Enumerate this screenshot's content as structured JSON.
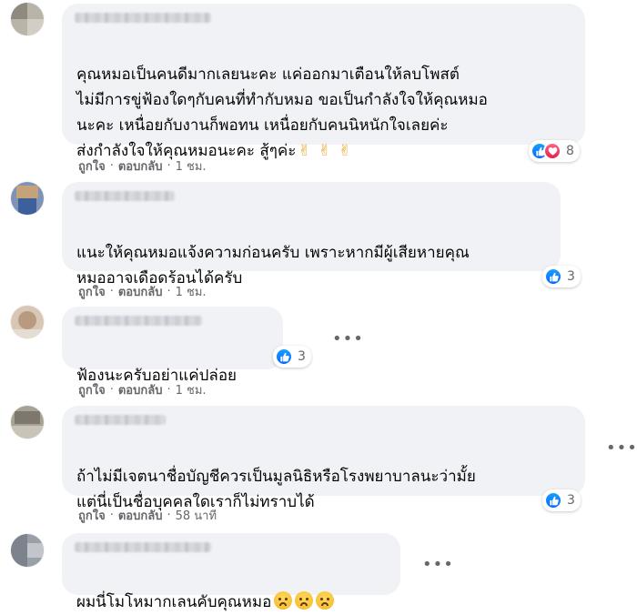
{
  "colors": {
    "bubble": "#f0f2f5",
    "muted": "#65676b",
    "like": "#0866ff",
    "love": "#f33e58"
  },
  "comments": [
    {
      "lines": "คุณหมอเป็นคนดีมากเลยนะคะ แค่ออกมาเตือนให้ลบโพสต์\nไม่มีการขู่ฟ้องใดๆกับคนที่ทำกับหมอ ขอเป็นกำลังใจให้คุณหมอ\nนะคะ เหนื่อยกับงานก็พอทน เหนื่อยกับคนนิหนักใจเลยค่ะ\nส่งกำลังใจให้คุณหมอนะคะ สู้ๆค่ะ",
      "emoji": "✌✌✌",
      "reaction_count": "8",
      "reactions": [
        "like-icon",
        "love-icon"
      ],
      "like_label": "ถูกใจ",
      "reply_label": "ตอบกลับ",
      "time": "1 ชม."
    },
    {
      "lines": "แนะให้คุณหมอแจ้งความก่อนครับ เพราะหากมีผู้เสียหายคุณ\nหมออาจเดือดร้อนได้ครับ",
      "reaction_count": "3",
      "reactions": [
        "like-icon"
      ],
      "like_label": "ถูกใจ",
      "reply_label": "ตอบกลับ",
      "time": "1 ชม."
    },
    {
      "lines": "ฟ้องนะครับอย่าแค่ปล่อย",
      "reaction_count": "3",
      "reactions": [
        "like-icon"
      ],
      "like_label": "ถูกใจ",
      "reply_label": "ตอบกลับ",
      "time": "1 ชม.",
      "more": "•••"
    },
    {
      "lines": "ถ้าไม่มีเจตนาชื่อบัญชีควรเป็นมูลนิธิหรือโรงพยาบาลนะว่ามั้ย\nแต่นี่เป็นชื่อบุคคลใดเราก็ไม่ทราบได้",
      "reaction_count": "3",
      "reactions": [
        "like-icon"
      ],
      "like_label": "ถูกใจ",
      "reply_label": "ตอบกลับ",
      "time": "58 นาที",
      "more": "•••"
    },
    {
      "lines": "ผมนี่โมโหมากเลนคับคุณหมอ",
      "emoji_icons": [
        "sad-face-icon",
        "sad-face-icon",
        "sad-face-icon"
      ],
      "more": "•••"
    }
  ]
}
